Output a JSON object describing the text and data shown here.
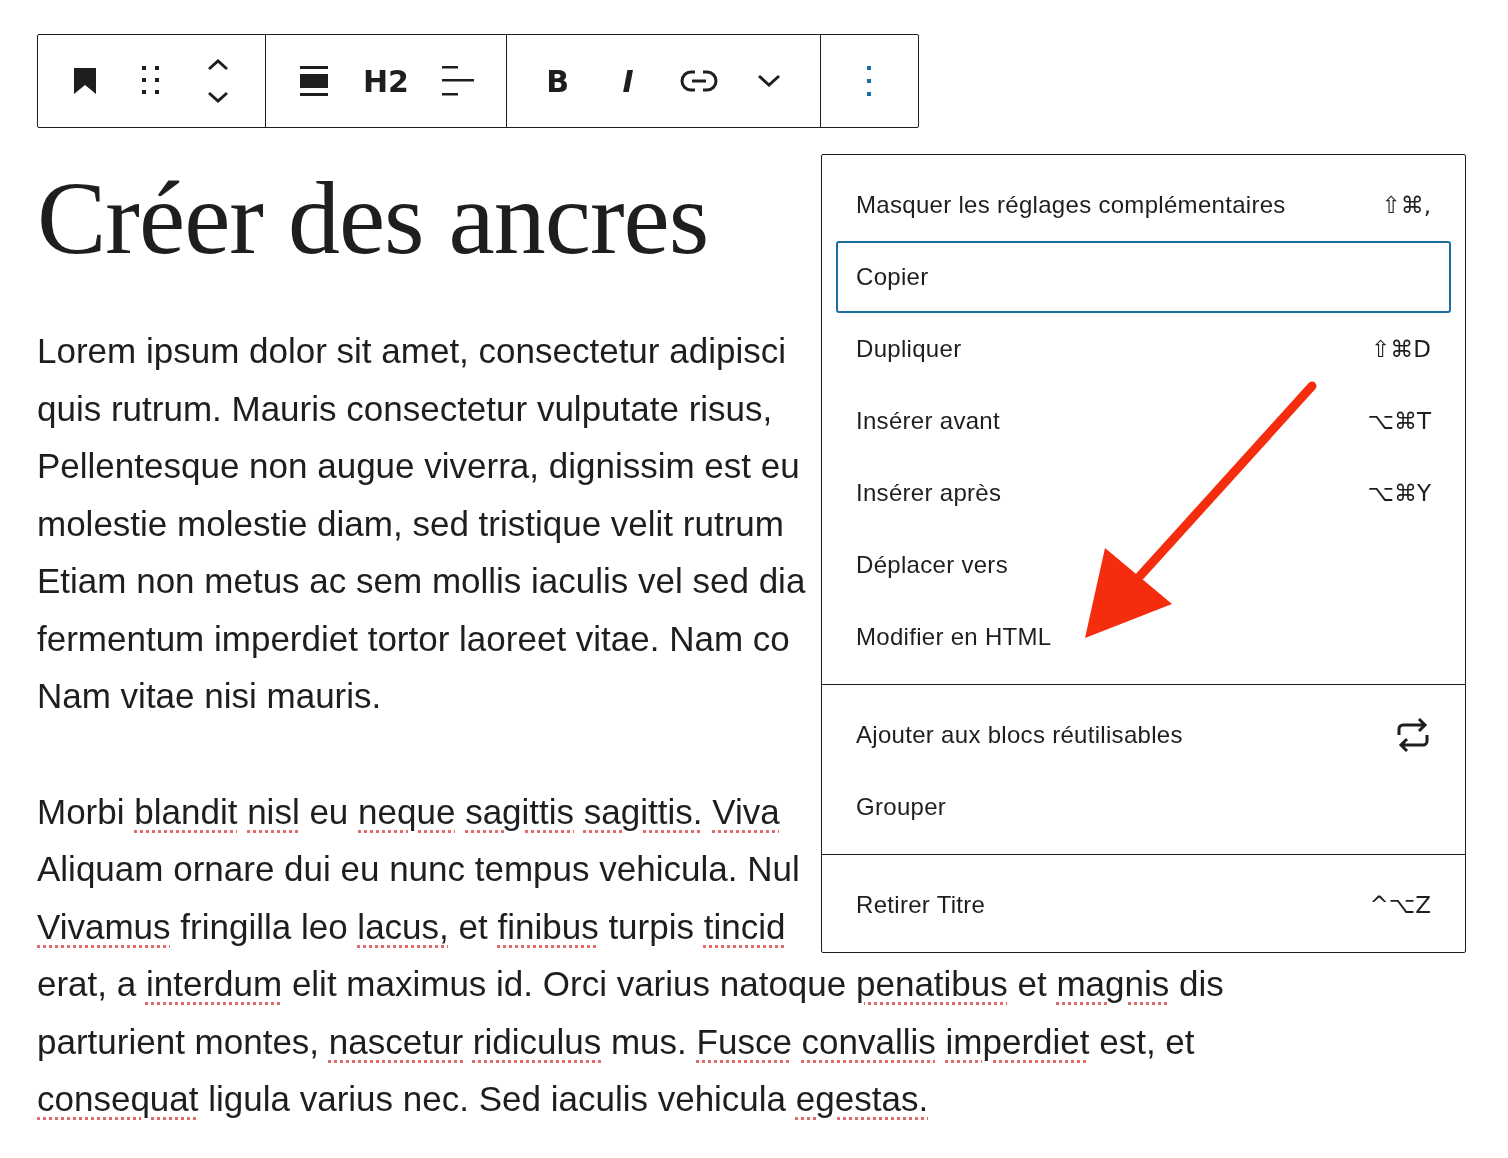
{
  "toolbar": {
    "groups": [
      [
        {
          "kind": "bookmark"
        },
        {
          "kind": "drag"
        },
        {
          "kind": "mover"
        }
      ],
      [
        {
          "kind": "align"
        },
        {
          "kind": "text",
          "label": "H2"
        },
        {
          "kind": "text-align"
        }
      ],
      [
        {
          "kind": "bold",
          "label": "B"
        },
        {
          "kind": "italic",
          "label": "I"
        },
        {
          "kind": "link"
        },
        {
          "kind": "chevron"
        }
      ],
      [
        {
          "kind": "options"
        }
      ]
    ]
  },
  "heading": "Créer des ancres",
  "paragraphs": [
    [
      [
        {
          "text": "Lorem ipsum dolor sit amet, consectetur adipisci",
          "misspelled": false
        }
      ],
      [
        {
          "text": "quis rutrum. Mauris consectetur vulputate risus,",
          "misspelled": false
        }
      ],
      [
        {
          "text": "Pellentesque non augue viverra, dignissim est eu",
          "misspelled": false
        }
      ],
      [
        {
          "text": "molestie molestie diam, sed tristique velit rutrum",
          "misspelled": false
        }
      ],
      [
        {
          "text": "Etiam non metus ac sem mollis iaculis vel sed dia",
          "misspelled": false
        }
      ],
      [
        {
          "text": "fermentum imperdiet tortor laoreet vitae. Nam co",
          "misspelled": false
        }
      ],
      [
        {
          "text": "Nam vitae nisi mauris.",
          "misspelled": false
        }
      ]
    ],
    [
      [
        {
          "text": "Morbi",
          "misspelled": false
        },
        {
          "text": "blandit",
          "misspelled": true
        },
        {
          "text": "nisl",
          "misspelled": true
        },
        {
          "text": "eu",
          "misspelled": false
        },
        {
          "text": "neque",
          "misspelled": true
        },
        {
          "text": "sagittis",
          "misspelled": true
        },
        {
          "text": "sagittis.",
          "misspelled": true
        },
        {
          "text": "Viva",
          "misspelled": true
        }
      ],
      [
        {
          "text": "Aliquam ornare dui eu nunc tempus vehicula. Nul",
          "misspelled": false
        }
      ],
      [
        {
          "text": "Vivamus",
          "misspelled": true
        },
        {
          "text": "fringilla leo",
          "misspelled": false
        },
        {
          "text": "lacus,",
          "misspelled": true
        },
        {
          "text": "et",
          "misspelled": false
        },
        {
          "text": "finibus",
          "misspelled": true
        },
        {
          "text": "turpis",
          "misspelled": false
        },
        {
          "text": "tincid",
          "misspelled": true
        }
      ],
      [
        {
          "text": "erat, a",
          "misspelled": false
        },
        {
          "text": "interdum",
          "misspelled": true
        },
        {
          "text": "elit maximus id. Orci varius natoque",
          "misspelled": false
        },
        {
          "text": "penatibus",
          "misspelled": true
        },
        {
          "text": "et",
          "misspelled": false
        },
        {
          "text": "magnis",
          "misspelled": true
        },
        {
          "text": "dis",
          "misspelled": false
        }
      ],
      [
        {
          "text": "parturient montes,",
          "misspelled": false
        },
        {
          "text": "nascetur",
          "misspelled": true
        },
        {
          "text": "ridiculus",
          "misspelled": true
        },
        {
          "text": "mus.",
          "misspelled": false
        },
        {
          "text": "Fusce",
          "misspelled": true
        },
        {
          "text": "convallis",
          "misspelled": true
        },
        {
          "text": "imperdiet",
          "misspelled": true
        },
        {
          "text": "est, et",
          "misspelled": false
        }
      ],
      [
        {
          "text": "consequat",
          "misspelled": true
        },
        {
          "text": "ligula varius nec. Sed iaculis vehicula",
          "misspelled": false
        },
        {
          "text": "egestas.",
          "misspelled": true
        }
      ]
    ]
  ],
  "menu": {
    "sections": [
      {
        "items": [
          {
            "kind": "shortcut",
            "label": "Masquer les réglages complémentaires",
            "shortcut": "⇧⌘,",
            "focused": false
          },
          {
            "kind": "plain",
            "label": "Copier",
            "focused": true
          },
          {
            "kind": "shortcut",
            "label": "Dupliquer",
            "shortcut": "⇧⌘D",
            "focused": false
          },
          {
            "kind": "shortcut",
            "label": "Insérer avant",
            "shortcut": "⌥⌘T",
            "focused": false
          },
          {
            "kind": "shortcut",
            "label": "Insérer après",
            "shortcut": "⌥⌘Y",
            "focused": false
          },
          {
            "kind": "plain",
            "label": "Déplacer vers",
            "focused": false
          },
          {
            "kind": "plain",
            "label": "Modifier en HTML",
            "focused": false
          }
        ]
      },
      {
        "items": [
          {
            "kind": "icon",
            "label": "Ajouter aux blocs réutilisables",
            "focused": false
          },
          {
            "kind": "plain",
            "label": "Grouper",
            "focused": false
          }
        ]
      },
      {
        "items": [
          {
            "kind": "shortcut",
            "label": "Retirer Titre",
            "shortcut": "^⌥Z",
            "focused": false
          }
        ]
      }
    ]
  }
}
